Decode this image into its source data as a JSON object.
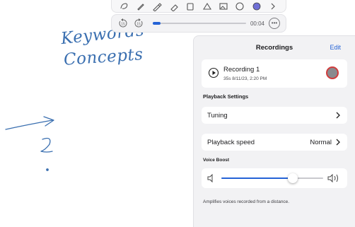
{
  "canvas": {
    "handwriting": [
      "Keywords",
      "Concepts"
    ],
    "ink_color": "#3a6fb0"
  },
  "toolbar": {
    "tools": [
      "lasso-icon",
      "pen-icon",
      "pencil-icon",
      "highlighter-icon",
      "eraser-icon",
      "shapes-icon",
      "image-icon",
      "stickers-icon",
      "color-picker-icon",
      "chevron-right-icon"
    ]
  },
  "playback": {
    "time": "00:04",
    "progress": 0.08,
    "skip_back_icon": "skip-back-15-icon",
    "skip_forward_icon": "skip-forward-15-icon",
    "more_icon": "more-options-icon"
  },
  "panel": {
    "title": "Recordings",
    "edit_label": "Edit",
    "recording": {
      "name": "Recording 1",
      "meta": "35s 8/11/23, 2:20 PM"
    },
    "playback_settings": {
      "heading": "Playback Settings",
      "tuning_label": "Tuning",
      "speed_label": "Playback speed",
      "speed_value": "Normal"
    },
    "voice_boost": {
      "heading": "Voice Boost",
      "level": 0.7,
      "description": "Amplifies voices recorded from a distance."
    }
  },
  "colors": {
    "accent": "#2563d6",
    "record": "#d13c3c",
    "panel_bg": "#f2f2f4"
  }
}
